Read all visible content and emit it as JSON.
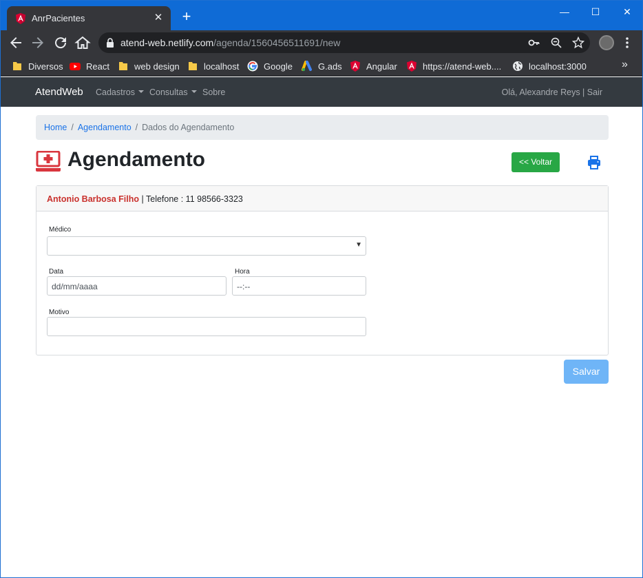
{
  "browser": {
    "tab_title": "AnrPacientes",
    "tab_close": "✕",
    "new_tab": "+",
    "window_controls": {
      "minimize": "—",
      "maximize": "☐",
      "close": "✕"
    },
    "url_host": "atend-web.netlify.com",
    "url_path": "/agenda/1560456511691/new",
    "bookmarks": [
      {
        "label": "Diversos",
        "icon": "folder-icon"
      },
      {
        "label": "React",
        "icon": "youtube-icon"
      },
      {
        "label": "web design",
        "icon": "folder-icon"
      },
      {
        "label": "localhost",
        "icon": "folder-icon"
      },
      {
        "label": "Google",
        "icon": "google-icon"
      },
      {
        "label": "G.ads",
        "icon": "google-ads-icon"
      },
      {
        "label": "Angular",
        "icon": "angular-icon"
      },
      {
        "label": "https://atend-web....",
        "icon": "angular-icon"
      },
      {
        "label": "localhost:3000",
        "icon": "globe-icon"
      }
    ],
    "bookmarks_more": "»"
  },
  "navbar": {
    "brand": "AtendWeb",
    "items": [
      {
        "label": "Cadastros",
        "dropdown": true
      },
      {
        "label": "Consultas",
        "dropdown": true
      },
      {
        "label": "Sobre",
        "dropdown": false
      }
    ],
    "greeting": "Olá, Alexandre Reys | Sair"
  },
  "breadcrumb": {
    "items": [
      {
        "label": "Home",
        "link": true
      },
      {
        "label": "Agendamento",
        "link": true
      },
      {
        "label": "Dados do Agendamento",
        "link": false
      }
    ],
    "separator": "/"
  },
  "page": {
    "title": "Agendamento",
    "back_button": "<< Voltar",
    "save_button": "Salvar"
  },
  "patient": {
    "name": "Antonio Barbosa Filho",
    "phone_text": " | Telefone : 11 98566-3323"
  },
  "form": {
    "medico_label": "Médico",
    "medico_value": "",
    "data_label": "Data",
    "data_placeholder": "dd/mm/aaaa",
    "hora_label": "Hora",
    "hora_placeholder": "--:--",
    "motivo_label": "Motivo",
    "motivo_value": ""
  },
  "colors": {
    "accent": "#1a73e8",
    "success": "#28a745",
    "danger": "#c9302c",
    "primary_disabled": "#6fb5f7",
    "navbar": "#343a40"
  }
}
